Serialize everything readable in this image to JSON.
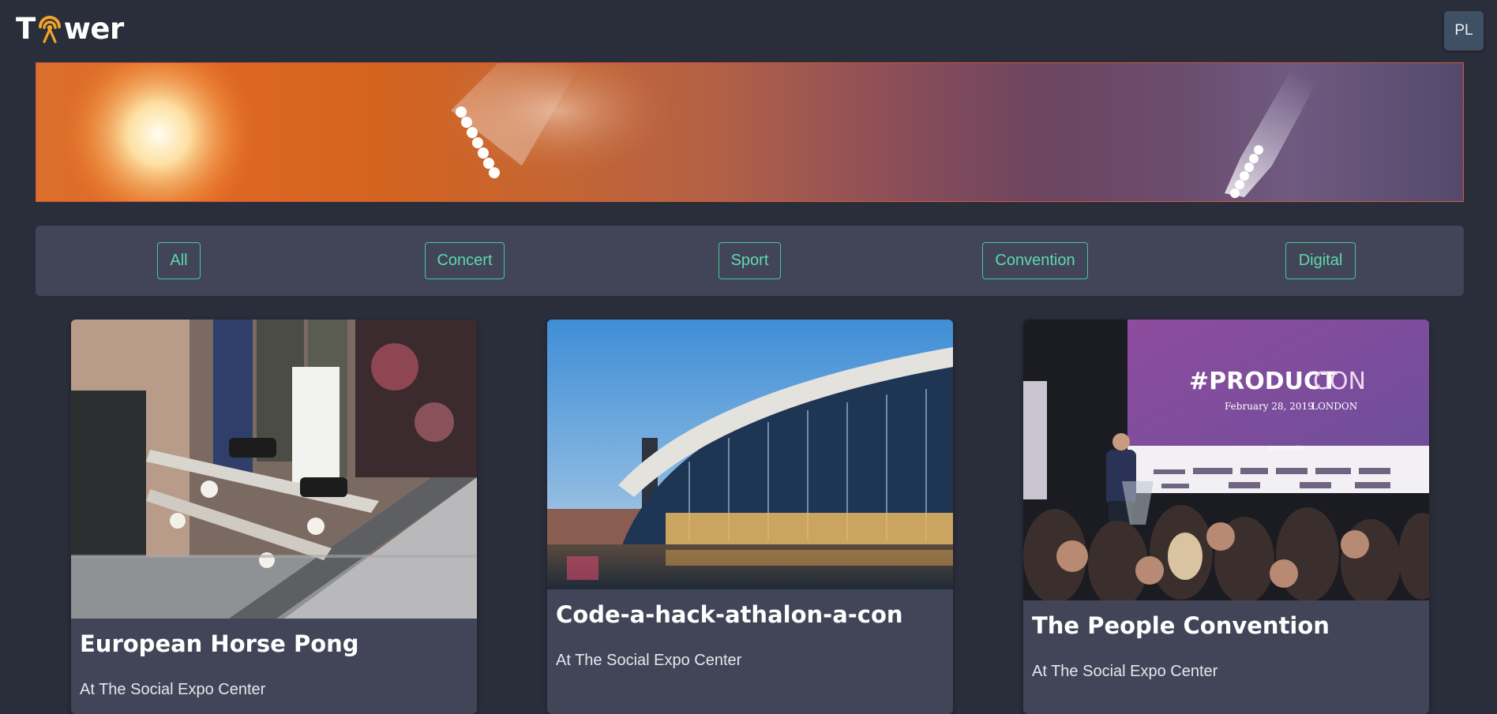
{
  "header": {
    "logo_text_left": "T",
    "logo_text_right": "wer",
    "logo_icon": "broadcast-tower-icon",
    "avatar_initials": "PL"
  },
  "banner": {
    "image": "stage-lights-banner"
  },
  "filters": [
    {
      "label": "All"
    },
    {
      "label": "Concert"
    },
    {
      "label": "Sport"
    },
    {
      "label": "Convention"
    },
    {
      "label": "Digital"
    }
  ],
  "events": [
    {
      "title": "European Horse Pong",
      "venue": "At The Social Expo Center",
      "image": "skateboarders-photo"
    },
    {
      "title": "Code-a-hack-athalon-a-con",
      "venue": "At The Social Expo Center",
      "image": "expo-building-photo"
    },
    {
      "title": "The People Convention",
      "venue": "At The Social Expo Center",
      "image": "conference-stage-photo",
      "screen_text": {
        "headline_a": "#PRODUCT",
        "headline_b": "CON",
        "date": "February 28, 2019",
        "city": "LONDON",
        "sponsored": "Sponsored by"
      }
    }
  ],
  "colors": {
    "background": "#2a2d3a",
    "panel": "#414557",
    "accent": "#45c99a",
    "avatar": "#3f5064"
  }
}
